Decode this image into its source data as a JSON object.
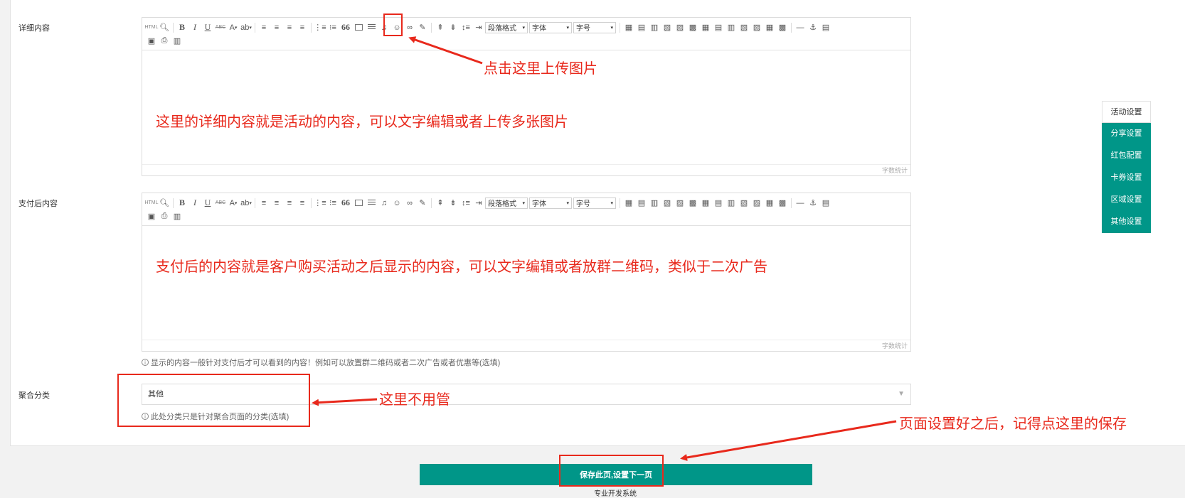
{
  "form": {
    "detail_label": "详细内容",
    "after_pay_label": "支付后内容",
    "category_label": "聚合分类"
  },
  "editor": {
    "toolbar_html_icon": "HTML",
    "bold": "B",
    "italic": "I",
    "underline": "U",
    "strike": "ABC",
    "font_color": "A",
    "quote": "66",
    "paragraph_format": "段落格式",
    "font_family": "字体",
    "font_size": "字号",
    "word_count": "字数统计"
  },
  "detail_editor": {
    "annotation": "这里的详细内容就是活动的内容，可以文字编辑或者上传多张图片"
  },
  "after_pay_editor": {
    "annotation": "支付后的内容就是客户购买活动之后显示的内容，可以文字编辑或者放群二维码，类似于二次广告",
    "hint": "显示的内容一般针对支付后才可以看到的内容！例如可以放置群二维码或者二次广告或者优惠等(选填)"
  },
  "category": {
    "selected": "其他",
    "hint": "此处分类只是针对聚合页面的分类(选填)"
  },
  "annotations": {
    "upload_image": "点击这里上传图片",
    "ignore_category": "这里不用管",
    "remember_save": "页面设置好之后，记得点这里的保存"
  },
  "side_nav": {
    "items": [
      "活动设置",
      "分享设置",
      "红包配置",
      "卡券设置",
      "区域设置",
      "其他设置"
    ]
  },
  "save_button": "保存此页,设置下一页",
  "footer": "专业开发系统",
  "colors": {
    "accent": "#009688",
    "annotation_red": "#e8291c"
  }
}
